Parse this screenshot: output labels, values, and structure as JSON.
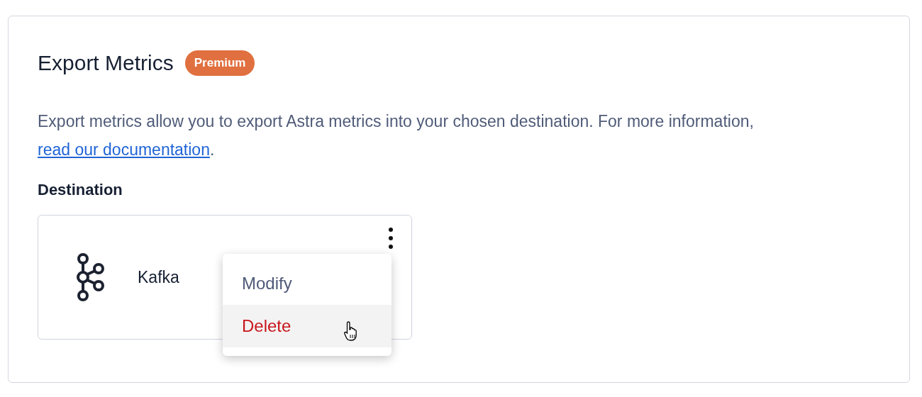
{
  "panel": {
    "title": "Export Metrics",
    "badge": "Premium",
    "description": {
      "before": "Export metrics allow you to export Astra metrics into your chosen destination. For more information, ",
      "link": "read our documentation",
      "after": "."
    },
    "section_label": "Destination",
    "destination": {
      "name": "Kafka",
      "menu": [
        {
          "label": "Modify",
          "kind": "default",
          "highlighted": false
        },
        {
          "label": "Delete",
          "kind": "danger",
          "highlighted": true
        }
      ]
    }
  }
}
